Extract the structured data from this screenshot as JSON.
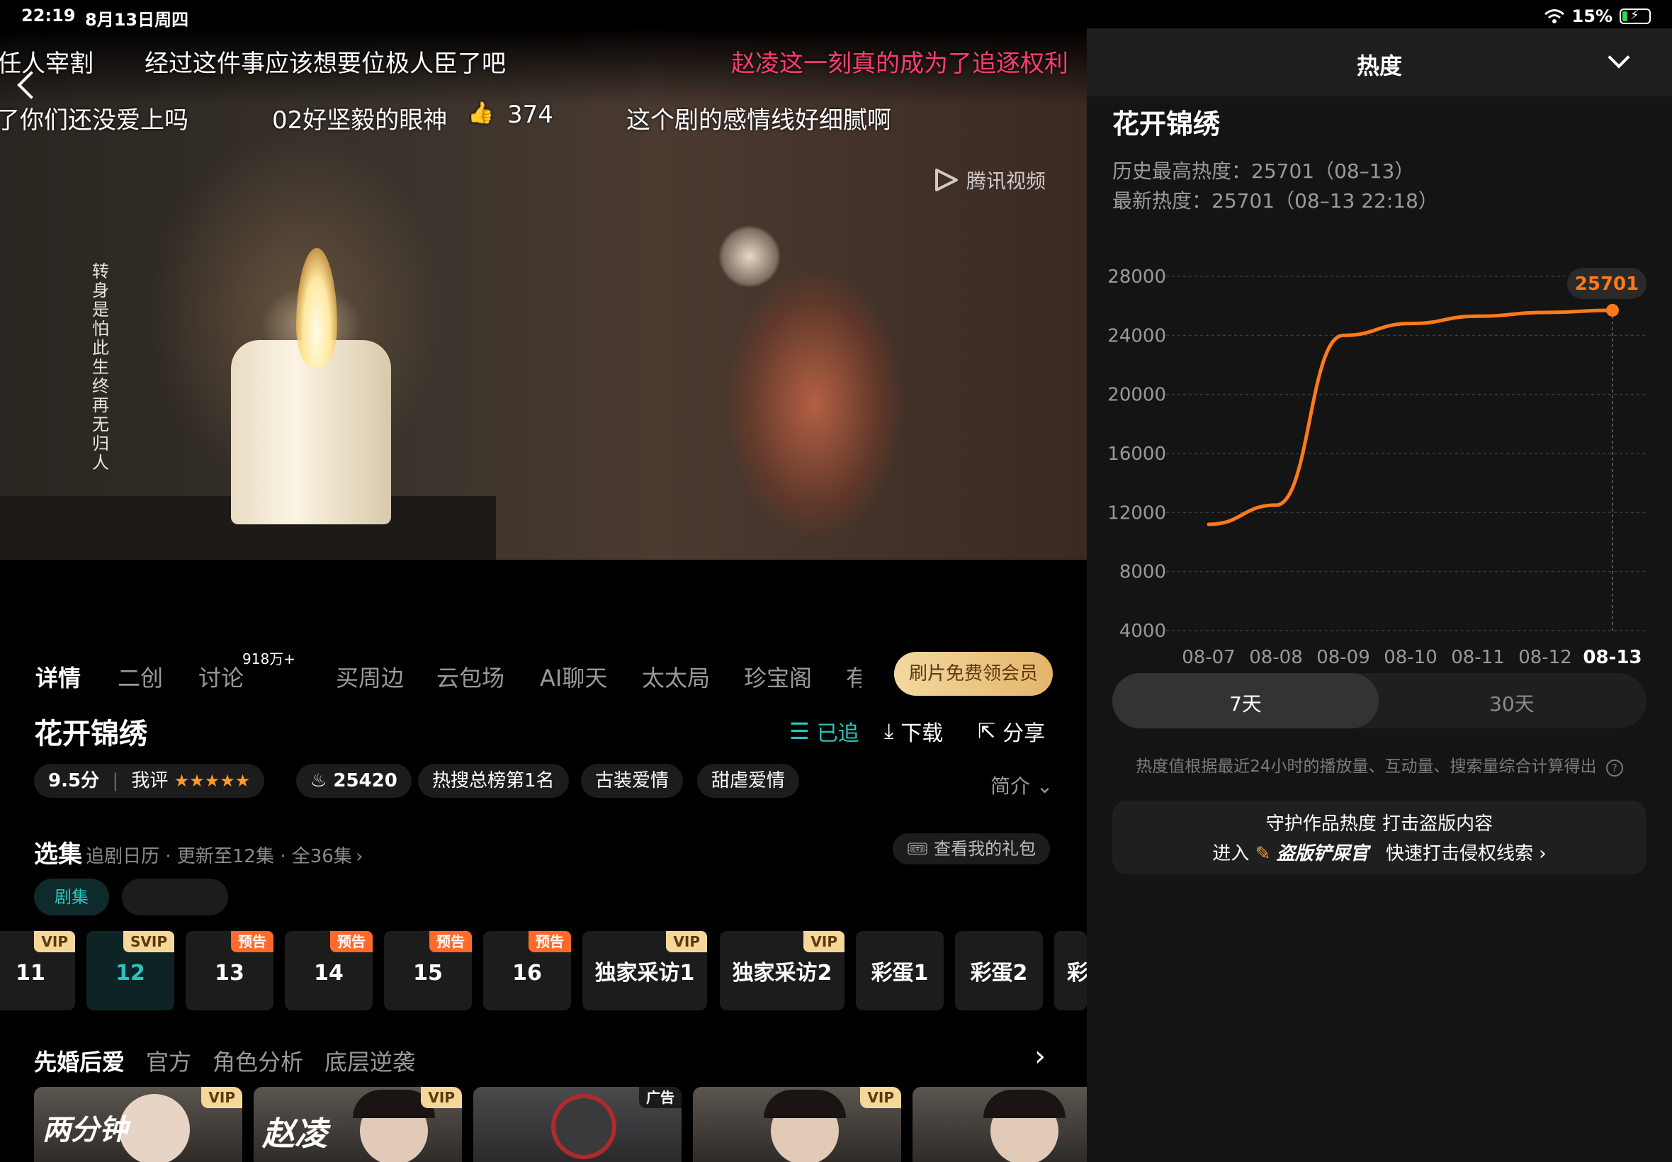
{
  "status": {
    "time": "22:19",
    "date": "8月13日周四",
    "battery": "15%"
  },
  "video": {
    "watermark": "腾讯视频",
    "vertical_text": "转身是怕此生终再无归人",
    "danmaku": [
      {
        "text": "任人宰割",
        "color": "#ffffff"
      },
      {
        "text": "经过这件事应该想要位极人臣了吧",
        "color": "#ffffff"
      },
      {
        "text": "赵凌这一刻真的成为了追逐权利",
        "color": "#ff3d6e"
      },
      {
        "text": "了你们还没爱上吗",
        "color": "#ffffff"
      },
      {
        "text": "02好坚毅的眼神",
        "color": "#ffffff"
      },
      {
        "text": "374",
        "color": "#ffffff"
      },
      {
        "text": "这个剧的感情线好细腻啊",
        "color": "#ffffff"
      }
    ]
  },
  "heat_panel": {
    "title": "热度",
    "show_name": "花开锦绣",
    "max_label": "历史最高热度：25701（08–13）",
    "latest_label": "最新热度：25701（08–13 22:18）",
    "range_7": "7天",
    "range_30": "30天",
    "note": "热度值根据最近24小时的播放量、互动量、搜索量综合计算得出",
    "card_line1": "守护作品热度 打击盗版内容",
    "card_enter": "进入",
    "card_brand": "盗版铲屎官",
    "card_action": "快速打击侵权线索"
  },
  "chart_data": {
    "type": "line",
    "x": [
      "08-07",
      "08-08",
      "08-09",
      "08-10",
      "08-11",
      "08-12",
      "08-13"
    ],
    "series": [
      {
        "values": [
          11200,
          12500,
          24000,
          24800,
          25300,
          25550,
          25701
        ]
      }
    ],
    "ylim": [
      4000,
      28000
    ],
    "yticks": [
      4000,
      8000,
      12000,
      16000,
      20000,
      24000,
      28000
    ],
    "highlight_label": "25701",
    "grid": true,
    "line_color": "#ff7a1a"
  },
  "tabs": [
    "详情",
    "二创",
    "讨论",
    "买周边",
    "云包场",
    "AI聊天",
    "太太局",
    "珍宝阁",
    "有"
  ],
  "discuss_badge": "918万+",
  "vip_button": "刷片免费领会员",
  "show": {
    "title": "花开锦绣",
    "followed": "已追",
    "download": "下载",
    "share": "分享",
    "score": "9.5分",
    "my_rating": "我评",
    "heat": "25420",
    "tag1": "热搜总榜第1名",
    "tag2": "古装爱情",
    "tag3": "甜虐爱情",
    "intro": "简介"
  },
  "episodes_section": {
    "title": "选集",
    "sub": "追剧日历 · 更新至12集 · 全36集",
    "gift": "查看我的礼包",
    "filter": "剧集"
  },
  "episodes": [
    {
      "label": "11",
      "badge": "VIP"
    },
    {
      "label": "12",
      "badge": "SVIP"
    },
    {
      "label": "13",
      "badge": "预告"
    },
    {
      "label": "14",
      "badge": "预告"
    },
    {
      "label": "15",
      "badge": "预告"
    },
    {
      "label": "16",
      "badge": "预告"
    },
    {
      "label": "独家采访1",
      "badge": "VIP"
    },
    {
      "label": "独家采访2",
      "badge": "VIP"
    },
    {
      "label": "彩蛋1",
      "badge": ""
    },
    {
      "label": "彩蛋2",
      "badge": ""
    },
    {
      "label": "彩",
      "badge": ""
    }
  ],
  "bottom_tabs": [
    "先婚后爱",
    "官方",
    "角色分析",
    "底层逆袭"
  ],
  "thumbs": [
    {
      "caption": "两分钟",
      "tag": "VIP"
    },
    {
      "caption": "赵凌",
      "tag": "VIP"
    },
    {
      "caption": "",
      "tag": "广告"
    },
    {
      "caption": "",
      "tag": "VIP"
    },
    {
      "caption": "",
      "tag": ""
    }
  ]
}
